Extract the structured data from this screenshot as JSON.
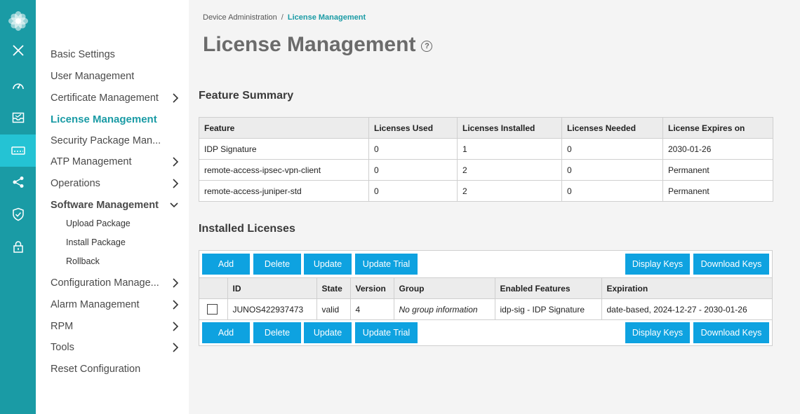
{
  "nav": {
    "items": [
      {
        "label": "Basic Settings",
        "chevron": false
      },
      {
        "label": "User Management",
        "chevron": false
      },
      {
        "label": "Certificate Management",
        "chevron": true
      },
      {
        "label": "License Management",
        "chevron": false,
        "active": true
      },
      {
        "label": "Security Package Man...",
        "chevron": false
      },
      {
        "label": "ATP Management",
        "chevron": true
      },
      {
        "label": "Operations",
        "chevron": true
      },
      {
        "label": "Software Management",
        "chevron": "down",
        "expanded": true
      },
      {
        "label": "Configuration Manage...",
        "chevron": true
      },
      {
        "label": "Alarm Management",
        "chevron": true
      },
      {
        "label": "RPM",
        "chevron": true
      },
      {
        "label": "Tools",
        "chevron": true
      },
      {
        "label": "Reset Configuration",
        "chevron": false
      }
    ],
    "software_sub": [
      "Upload Package",
      "Install Package",
      "Rollback"
    ]
  },
  "breadcrumb": {
    "parent": "Device Administration",
    "separator": "/",
    "current": "License Management"
  },
  "page": {
    "title": "License Management",
    "help": "?"
  },
  "feature_summary": {
    "title": "Feature Summary",
    "columns": [
      "Feature",
      "Licenses Used",
      "Licenses Installed",
      "Licenses Needed",
      "License Expires on"
    ],
    "rows": [
      [
        "IDP Signature",
        "0",
        "1",
        "0",
        "2030-01-26"
      ],
      [
        "remote-access-ipsec-vpn-client",
        "0",
        "2",
        "0",
        "Permanent"
      ],
      [
        "remote-access-juniper-std",
        "0",
        "2",
        "0",
        "Permanent"
      ]
    ]
  },
  "installed": {
    "title": "Installed Licenses",
    "buttons": {
      "add": "Add",
      "delete": "Delete",
      "update": "Update",
      "update_trial": "Update Trial",
      "display_keys": "Display Keys",
      "download_keys": "Download Keys"
    },
    "columns": [
      "",
      "ID",
      "State",
      "Version",
      "Group",
      "Enabled Features",
      "Expiration"
    ],
    "rows": [
      [
        "",
        "JUNOS422937473",
        "valid",
        "4",
        "No group information",
        "idp-sig - IDP Signature",
        "date-based, 2024-12-27 - 2030-01-26"
      ]
    ]
  },
  "colors": {
    "rail": "#1a9ba5",
    "rail_active": "#24c3d4",
    "accent": "#1a9ba5",
    "button": "#0ea2e0"
  },
  "rail_icons": [
    "flower-logo-icon",
    "close-icon",
    "dashboard-gauge-icon",
    "monitor-inbox-icon",
    "device-admin-icon",
    "network-share-icon",
    "shield-check-icon",
    "lock-icon"
  ]
}
